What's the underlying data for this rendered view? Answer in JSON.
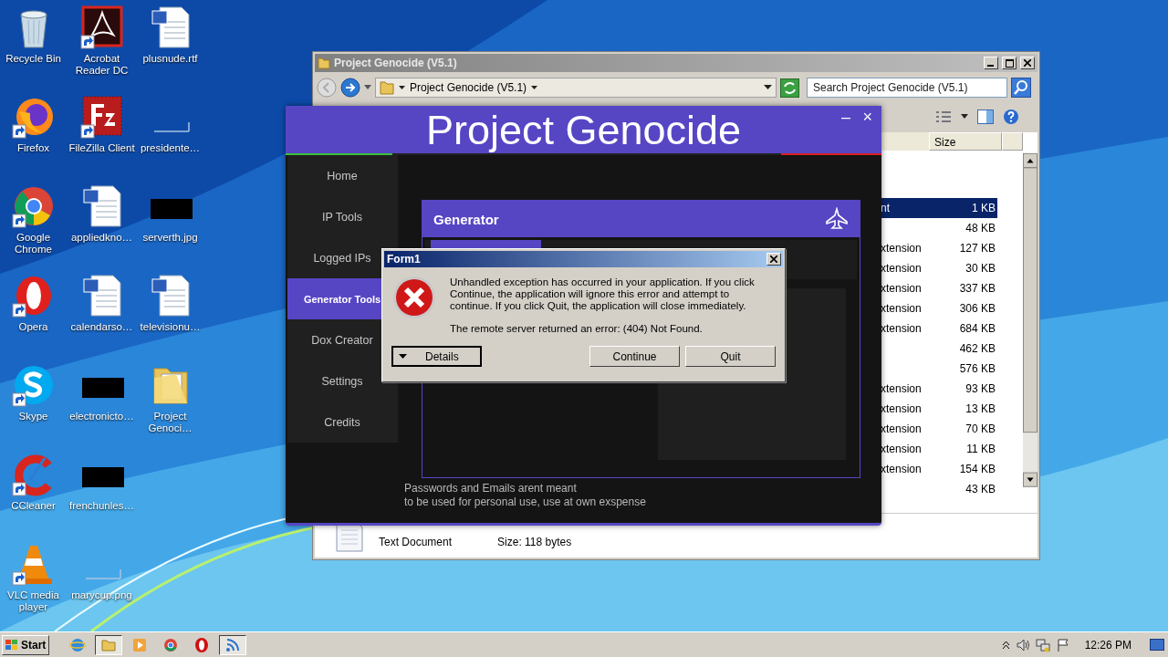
{
  "desktop_icons": [
    {
      "label": "Recycle Bin",
      "kind": "recycle",
      "shortcut": false
    },
    {
      "label": "Firefox",
      "kind": "firefox",
      "shortcut": true
    },
    {
      "label": "Google Chrome",
      "kind": "chrome",
      "shortcut": true
    },
    {
      "label": "Opera",
      "kind": "opera",
      "shortcut": true
    },
    {
      "label": "Skype",
      "kind": "skype",
      "shortcut": true
    },
    {
      "label": "CCleaner",
      "kind": "ccleaner",
      "shortcut": true
    },
    {
      "label": "VLC media player",
      "kind": "vlc",
      "shortcut": true
    },
    {
      "label": "Acrobat Reader DC",
      "kind": "acrobat",
      "shortcut": true
    },
    {
      "label": "FileZilla Client",
      "kind": "filezilla",
      "shortcut": true
    },
    {
      "label": "appliedkno…",
      "kind": "word",
      "shortcut": false
    },
    {
      "label": "calendarso…",
      "kind": "word",
      "shortcut": false
    },
    {
      "label": "electronicto…",
      "kind": "black-image",
      "shortcut": false
    },
    {
      "label": "frenchunles…",
      "kind": "black-image",
      "shortcut": false
    },
    {
      "label": "marycup.png",
      "kind": "blank-image",
      "shortcut": false
    },
    {
      "label": "plusnude.rtf",
      "kind": "word",
      "shortcut": false
    },
    {
      "label": "presidente…",
      "kind": "blank-image",
      "shortcut": false
    },
    {
      "label": "serverth.jpg",
      "kind": "black-image",
      "shortcut": false
    },
    {
      "label": "televisionu…",
      "kind": "word",
      "shortcut": false
    },
    {
      "label": "Project Genoci…",
      "kind": "folder",
      "shortcut": false
    }
  ],
  "explorer": {
    "title": "Project Genocide (V5.1)",
    "address": "Project Genocide (V5.1)",
    "search": {
      "placeholder": "Search Project Genocide (V5.1)"
    },
    "columns": [
      "Size"
    ],
    "rows": [
      {
        "type": "nt",
        "size": "1 KB",
        "selected": true
      },
      {
        "size": "48 KB",
        "selected": false
      },
      {
        "type": "xtension",
        "size": "127 KB",
        "selected": false
      },
      {
        "type": "xtension",
        "size": "30 KB",
        "selected": false
      },
      {
        "type": "xtension",
        "size": "337 KB",
        "selected": false
      },
      {
        "type": "xtension",
        "size": "306 KB",
        "selected": false
      },
      {
        "type": "xtension",
        "size": "684 KB",
        "selected": false
      },
      {
        "size": "462 KB",
        "selected": false
      },
      {
        "size": "576 KB",
        "selected": false
      },
      {
        "type": "xtension",
        "size": "93 KB",
        "selected": false
      },
      {
        "type": "xtension",
        "size": "13 KB",
        "selected": false
      },
      {
        "type": "xtension",
        "size": "70 KB",
        "selected": false
      },
      {
        "type": "xtension",
        "size": "11 KB",
        "selected": false
      },
      {
        "type": "xtension",
        "size": "154 KB",
        "selected": false
      },
      {
        "size": "43 KB",
        "selected": false
      }
    ],
    "details": {
      "type": "Text Document",
      "size": "Size: 118 bytes"
    }
  },
  "app": {
    "title": "Project Genocide",
    "controls": [
      "–",
      "×"
    ],
    "nav": [
      {
        "label": "Home",
        "selected": false
      },
      {
        "label": "IP Tools",
        "selected": false
      },
      {
        "label": "Logged IPs",
        "selected": false
      },
      {
        "label": "Generator Tools",
        "selected": true
      },
      {
        "label": "Dox Creator",
        "selected": false
      },
      {
        "label": "Settings",
        "selected": false
      },
      {
        "label": "Credits",
        "selected": false
      }
    ],
    "panel": {
      "title": "Generator"
    },
    "footer": "Passwords and Emails arent meant\nto be used for personal use, use at own exspense"
  },
  "dialog": {
    "title": "Form1",
    "message": "Unhandled exception has occurred in your application. If you click Continue, the application will ignore this error and attempt to continue. If you click Quit, the application will close immediately.",
    "error": "The remote server returned an error: (404) Not Found.",
    "buttons": [
      {
        "label": "Details",
        "kind": "expander"
      },
      {
        "label": "Continue",
        "kind": "plain"
      },
      {
        "label": "Quit",
        "kind": "plain"
      }
    ]
  },
  "taskbar": {
    "start": "Start",
    "apps": [
      {
        "kind": "ie",
        "active": false
      },
      {
        "kind": "explorer",
        "active": true
      },
      {
        "kind": "media",
        "active": false
      },
      {
        "kind": "chrome",
        "active": false
      },
      {
        "kind": "opera",
        "active": false
      },
      {
        "kind": "feed",
        "active": true
      }
    ],
    "clock": "12:26 PM"
  }
}
